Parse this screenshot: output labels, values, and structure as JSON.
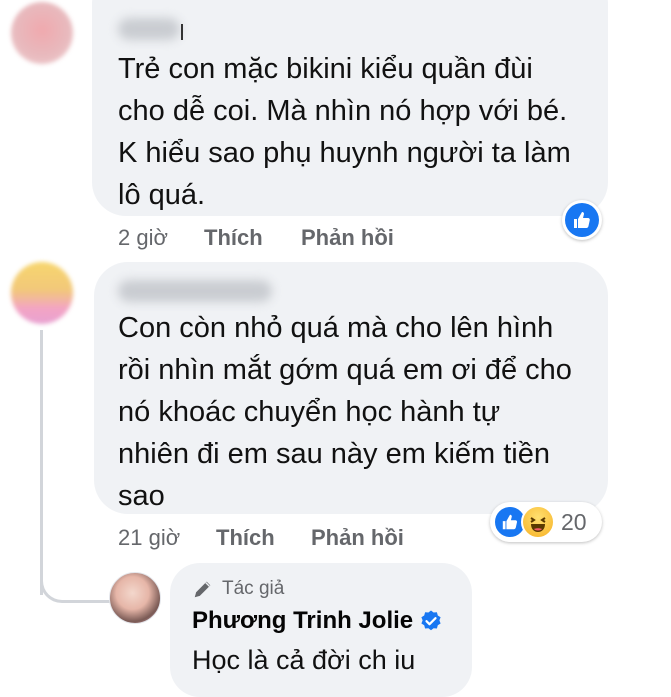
{
  "comment1": {
    "text": "Trẻ con mặc bikini kiểu quần đùi\ncho dễ coi. Mà nhìn nó hợp với bé.\nK hiểu sao phụ huynh người ta làm\nlô quá.",
    "time": "2 giờ",
    "like_label": "Thích",
    "reply_label": "Phản hồi",
    "reactions": [
      "like-icon"
    ],
    "colors": {
      "like": "#1877f2"
    }
  },
  "comment2": {
    "text": "Con còn nhỏ quá mà cho lên hình\nrồi nhìn mắt gớm quá em ơi để cho\nnó khoác chuyển học hành tự\nnhiên đi em sau này em kiếm tiền\nsao",
    "time": "21 giờ",
    "like_label": "Thích",
    "reply_label": "Phản hồi",
    "reactions": [
      "like-icon",
      "haha-icon"
    ],
    "reaction_count": "20"
  },
  "reply": {
    "badge": "Tác giả",
    "author": "Phương Trinh Jolie",
    "text": "Học là cả đời ch iu",
    "verified_color": "#1877f2"
  }
}
